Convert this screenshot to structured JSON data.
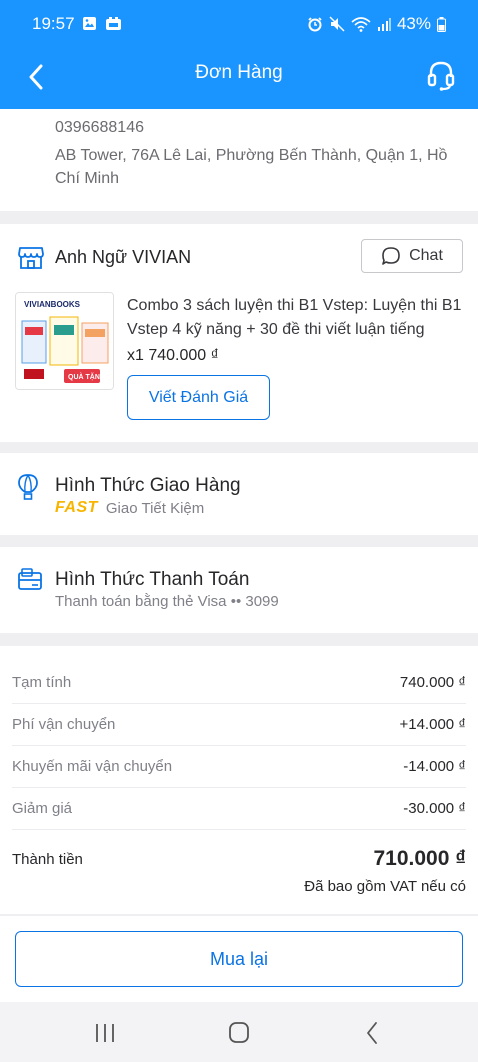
{
  "status": {
    "time": "19:57",
    "battery": "43%"
  },
  "header": {
    "title": "Đơn Hàng"
  },
  "address": {
    "phone": "0396688146",
    "line": "AB Tower, 76A Lê Lai, Phường Bến Thành, Quận 1, Hồ Chí Minh"
  },
  "shop": {
    "name": "Anh Ngữ VIVIAN",
    "chat_label": "Chat",
    "product": {
      "name": "Combo 3 sách luyện thi B1 Vstep: Luyện thi B1 Vstep 4 kỹ năng + 30 đề thi viết luận tiếng",
      "qty_price": "x1  740.000 ₫",
      "image_brand": "VIVIANBOOKS",
      "image_badge": "QUÀ TẶNG"
    },
    "review_label": "Viết Đánh Giá"
  },
  "shipping": {
    "title": "Hình Thức Giao Hàng",
    "badge": "FAST",
    "method": "Giao Tiết Kiệm"
  },
  "payment": {
    "title": "Hình Thức Thanh Toán",
    "method": "Thanh toán bằng thẻ Visa •• 3099"
  },
  "totals": {
    "rows": [
      {
        "label": "Tạm tính",
        "value": "740.000 ₫"
      },
      {
        "label": "Phí vận chuyển",
        "value": "+14.000 ₫"
      },
      {
        "label": "Khuyến mãi vận chuyển",
        "value": "-14.000 ₫"
      },
      {
        "label": "Giảm giá",
        "value": "-30.000 ₫"
      }
    ],
    "grand_label": "Thành tiền",
    "grand_value": "710.000 ₫",
    "vat_note": "Đã bao gồm VAT nếu có"
  },
  "actions": {
    "rebuy_label": "Mua lại"
  },
  "colors": {
    "primary": "#1a94ff",
    "button_blue": "#0b74e5",
    "fast_yellow": "#f7b500"
  }
}
